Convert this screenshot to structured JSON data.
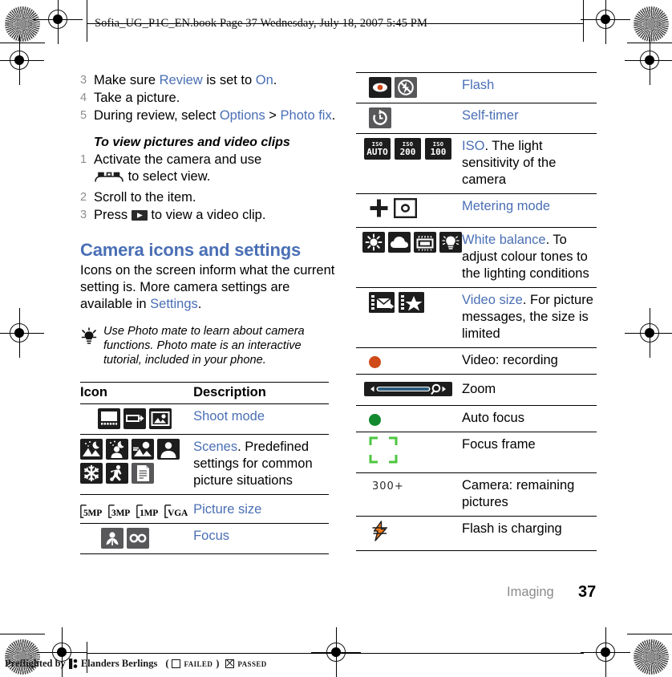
{
  "header": {
    "filename_line": "Sofia_UG_P1C_EN.book  Page 37  Wednesday, July 18, 2007  5:45 PM"
  },
  "left_column": {
    "steps_continued": [
      {
        "num": "3",
        "parts": [
          {
            "t": "Make sure ",
            "link": false
          },
          {
            "t": "Review",
            "link": true
          },
          {
            "t": " is set to ",
            "link": false
          },
          {
            "t": "On",
            "link": true
          },
          {
            "t": ".",
            "link": false
          }
        ]
      },
      {
        "num": "4",
        "parts": [
          {
            "t": "Take a picture.",
            "link": false
          }
        ]
      },
      {
        "num": "5",
        "parts": [
          {
            "t": "During review, select ",
            "link": false
          },
          {
            "t": "Options",
            "link": true
          },
          {
            "t": " > ",
            "link": false
          },
          {
            "t": "Photo fix",
            "link": true
          },
          {
            "t": ".",
            "link": false
          }
        ]
      }
    ],
    "procedure_title": "To view pictures and video clips",
    "procedure_steps": [
      {
        "num": "1",
        "text_before": "Activate the camera and use",
        "icon": "camera-key-icon",
        "text_after": " to select view."
      },
      {
        "num": "2",
        "text_before": "Scroll to the item.",
        "icon": "",
        "text_after": ""
      },
      {
        "num": "3",
        "text_before": "Press ",
        "icon": "play-key-icon",
        "text_after": " to view a video clip."
      }
    ],
    "section_heading": "Camera icons and settings",
    "section_paragraph_parts": [
      {
        "t": "Icons on the screen inform what the current setting is. More camera settings are available in ",
        "link": false
      },
      {
        "t": "Settings",
        "link": true
      },
      {
        "t": ".",
        "link": false
      }
    ],
    "tip_text": "Use Photo mate to learn about camera functions. Photo mate is an interactive tutorial, included in your phone.",
    "table": {
      "headers": {
        "icon": "Icon",
        "description": "Description"
      },
      "rows": [
        {
          "icons": [
            "shoot-mode-panorama-icon",
            "shoot-mode-burst-icon",
            "shoot-mode-photo-icon"
          ],
          "desc_parts": [
            {
              "t": "Shoot mode",
              "link": true
            }
          ]
        },
        {
          "icons": [
            "scene-night-landscape-icon",
            "scene-night-portrait-icon",
            "scene-landscape-icon",
            "scene-portrait-icon",
            "scene-snow-icon",
            "scene-sports-icon",
            "scene-document-icon"
          ],
          "desc_parts": [
            {
              "t": "Scenes",
              "link": true
            },
            {
              "t": ". Predefined settings for common picture situations",
              "link": false
            }
          ]
        },
        {
          "icons": [
            "picture-size-5mp-icon",
            "picture-size-3mp-icon",
            "picture-size-1mp-icon",
            "picture-size-vga-icon"
          ],
          "labels": [
            "5MP",
            "3MP",
            "1MP",
            "VGA"
          ],
          "desc_parts": [
            {
              "t": "Picture size",
              "link": true
            }
          ]
        },
        {
          "icons": [
            "focus-macro-icon",
            "focus-infinity-icon"
          ],
          "desc_parts": [
            {
              "t": "Focus",
              "link": true
            }
          ]
        }
      ]
    }
  },
  "right_column": {
    "table": {
      "rows": [
        {
          "icons": [
            "flash-redeye-icon",
            "flash-off-icon"
          ],
          "desc_parts": [
            {
              "t": "Flash",
              "link": true
            }
          ]
        },
        {
          "icons": [
            "self-timer-icon"
          ],
          "desc_parts": [
            {
              "t": "Self-timer",
              "link": true
            }
          ]
        },
        {
          "icons": [
            "iso-auto-icon",
            "iso-200-icon",
            "iso-100-icon"
          ],
          "iso_labels": [
            [
              "ISO",
              "AUTO"
            ],
            [
              "ISO",
              "200"
            ],
            [
              "ISO",
              "100"
            ]
          ],
          "desc_parts": [
            {
              "t": "ISO",
              "link": true
            },
            {
              "t": ". The light sensitivity of the camera",
              "link": false
            }
          ]
        },
        {
          "icons": [
            "metering-spot-cross-icon",
            "metering-centre-icon"
          ],
          "desc_parts": [
            {
              "t": "Metering mode",
              "link": true
            }
          ]
        },
        {
          "icons": [
            "wb-daylight-icon",
            "wb-cloudy-icon",
            "wb-fluorescent-icon",
            "wb-incandescent-icon"
          ],
          "desc_parts": [
            {
              "t": "White balance",
              "link": true
            },
            {
              "t": ". To adjust colour tones to the lighting conditions",
              "link": false
            }
          ]
        },
        {
          "icons": [
            "video-size-message-icon",
            "video-size-high-icon"
          ],
          "desc_parts": [
            {
              "t": "Video size",
              "link": true
            },
            {
              "t": ". For picture messages, the size is limited",
              "link": false
            }
          ]
        },
        {
          "icons": [
            "video-recording-dot-icon"
          ],
          "desc_parts": [
            {
              "t": "Video: recording",
              "link": false
            }
          ]
        },
        {
          "icons": [
            "zoom-slider-icon"
          ],
          "desc_parts": [
            {
              "t": "Zoom",
              "link": false
            }
          ]
        },
        {
          "icons": [
            "auto-focus-dot-icon"
          ],
          "desc_parts": [
            {
              "t": "Auto focus",
              "link": false
            }
          ]
        },
        {
          "icons": [
            "focus-frame-icon"
          ],
          "desc_parts": [
            {
              "t": "Focus frame",
              "link": false
            }
          ]
        },
        {
          "icons": [
            "remaining-pictures-counter"
          ],
          "counter_text": "300+",
          "desc_parts": [
            {
              "t": "Camera: remaining pictures",
              "link": false
            }
          ]
        },
        {
          "icons": [
            "flash-charging-icon"
          ],
          "desc_parts": [
            {
              "t": "Flash is charging",
              "link": false
            }
          ]
        }
      ]
    }
  },
  "footer": {
    "chapter": "Imaging",
    "page_number": "37",
    "preflight_prefix": "Preflighted by",
    "preflight_company": "Elanders Berlings",
    "preflight_failed_open": "(",
    "preflight_failed": "FAILED",
    "preflight_failed_close": ")",
    "preflight_passed": "PASSED"
  },
  "colors": {
    "link": "#4a6fb5",
    "heading": "#4a6fb5",
    "step_number": "#8e8e8e",
    "record_red": "#cf4a18",
    "focus_green": "#138a2f",
    "frame_green": "#4cc63f",
    "flash_orange": "#ef7b1b",
    "icon_dark": "#1d1d1d"
  }
}
